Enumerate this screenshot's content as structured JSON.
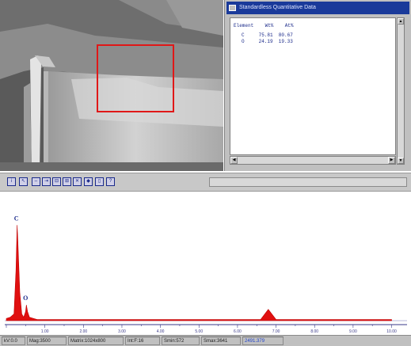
{
  "quant_window": {
    "title": "Standardless Quantitative Data",
    "header": "Element    Wt%    At%",
    "rows": [
      {
        "line": "C     75.81  80.67"
      },
      {
        "line": "O     24.19  19.33"
      }
    ]
  },
  "spectrum": {
    "peak_labels": [
      "C",
      "O"
    ],
    "axis_ticks": [
      "1.00",
      "2.00",
      "3.00",
      "4.00",
      "5.00",
      "6.00",
      "7.00",
      "8.00",
      "9.00",
      "10.00"
    ]
  },
  "chart_data": {
    "type": "area",
    "x": [
      0.0,
      0.1,
      0.2,
      0.25,
      0.28,
      0.3,
      0.35,
      0.4,
      0.45,
      0.5,
      0.52,
      0.55,
      0.6,
      0.7,
      0.8,
      1.0,
      2.0,
      3.0,
      4.0,
      5.0,
      6.0,
      6.6,
      6.8,
      7.0,
      8.0,
      9.0,
      10.0
    ],
    "y": [
      2,
      3,
      6,
      45,
      85,
      70,
      25,
      6,
      3,
      8,
      14,
      8,
      3,
      2,
      1,
      1,
      1,
      1,
      1,
      1,
      1,
      1,
      10,
      1,
      1,
      1,
      1
    ],
    "peaks": [
      {
        "label": "C",
        "x": 0.28
      },
      {
        "label": "O",
        "x": 0.52
      }
    ],
    "xlim": [
      0,
      10.4
    ],
    "ylim": [
      0,
      100
    ],
    "color": "#e01010"
  },
  "statusbar": {
    "kv": "kV:0.0",
    "mag": "Mag:3500",
    "matrix": "Matrix:1024x800",
    "int": "Int:F:16",
    "smin": "Smin:572",
    "smax": "Smax:3641",
    "value": "2491.379"
  },
  "colors": {
    "title_bar": "#1a3a9a",
    "roi": "#e01818",
    "spectrum_fill": "#e01010",
    "peak_label": "#1a2a8a"
  }
}
